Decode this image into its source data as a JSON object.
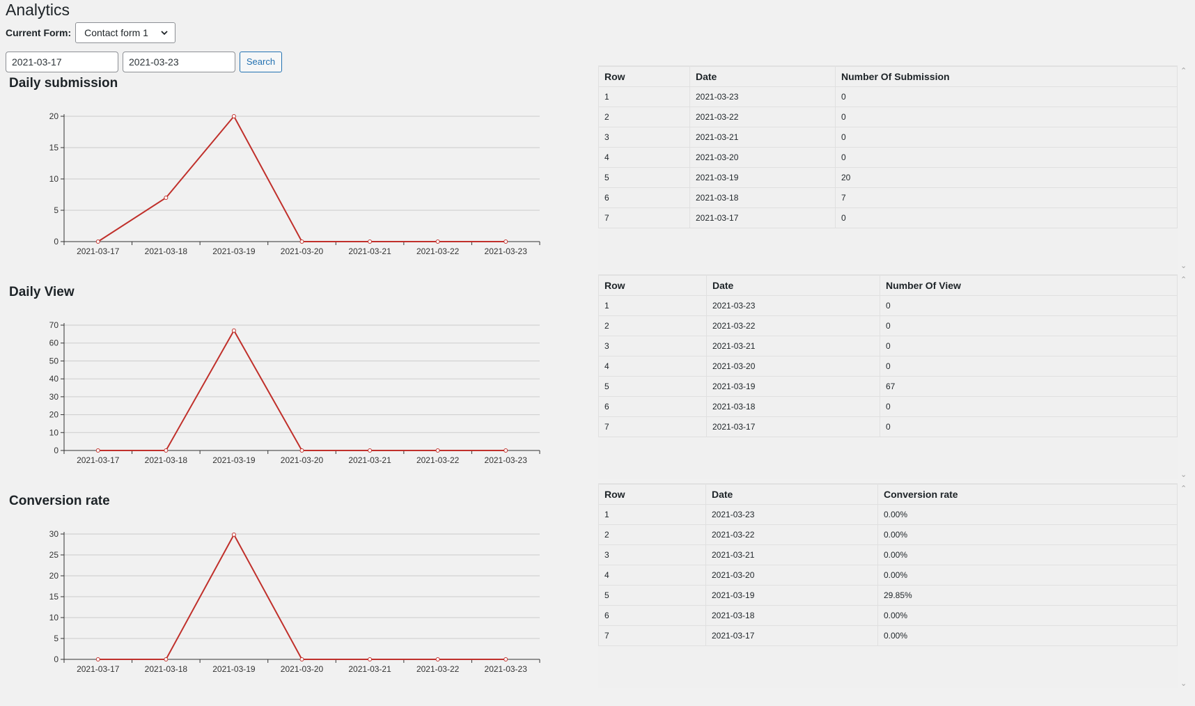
{
  "page": {
    "title": "Analytics",
    "current_form_label": "Current Form:",
    "current_form_value": "Contact form 1",
    "date_from": "2021-03-17",
    "date_to": "2021-03-23",
    "search_label": "Search"
  },
  "colors": {
    "line": "#c0302b",
    "accent": "#2271b1"
  },
  "icons": {
    "select": "chevron-down-icon",
    "scroll_up": "chevron-up-icon",
    "scroll_down": "chevron-down-icon"
  },
  "sections": [
    {
      "title": "Daily submission",
      "table_headers": [
        "Row",
        "Date",
        "Number Of Submission"
      ],
      "rows": [
        [
          "1",
          "2021-03-23",
          "0"
        ],
        [
          "2",
          "2021-03-22",
          "0"
        ],
        [
          "3",
          "2021-03-21",
          "0"
        ],
        [
          "4",
          "2021-03-20",
          "0"
        ],
        [
          "5",
          "2021-03-19",
          "20"
        ],
        [
          "6",
          "2021-03-18",
          "7"
        ],
        [
          "7",
          "2021-03-17",
          "0"
        ]
      ]
    },
    {
      "title": "Daily View",
      "table_headers": [
        "Row",
        "Date",
        "Number Of View"
      ],
      "rows": [
        [
          "1",
          "2021-03-23",
          "0"
        ],
        [
          "2",
          "2021-03-22",
          "0"
        ],
        [
          "3",
          "2021-03-21",
          "0"
        ],
        [
          "4",
          "2021-03-20",
          "0"
        ],
        [
          "5",
          "2021-03-19",
          "67"
        ],
        [
          "6",
          "2021-03-18",
          "0"
        ],
        [
          "7",
          "2021-03-17",
          "0"
        ]
      ]
    },
    {
      "title": "Conversion rate",
      "table_headers": [
        "Row",
        "Date",
        "Conversion rate"
      ],
      "rows": [
        [
          "1",
          "2021-03-23",
          "0.00%"
        ],
        [
          "2",
          "2021-03-22",
          "0.00%"
        ],
        [
          "3",
          "2021-03-21",
          "0.00%"
        ],
        [
          "4",
          "2021-03-20",
          "0.00%"
        ],
        [
          "5",
          "2021-03-19",
          "29.85%"
        ],
        [
          "6",
          "2021-03-18",
          "0.00%"
        ],
        [
          "7",
          "2021-03-17",
          "0.00%"
        ]
      ]
    }
  ],
  "chart_data": [
    {
      "type": "line",
      "categories": [
        "2021-03-17",
        "2021-03-18",
        "2021-03-19",
        "2021-03-20",
        "2021-03-21",
        "2021-03-22",
        "2021-03-23"
      ],
      "values": [
        0,
        7,
        20,
        0,
        0,
        0,
        0
      ],
      "yticks": [
        0,
        5,
        10,
        15,
        20
      ],
      "ylim": [
        0,
        20
      ],
      "grid": true
    },
    {
      "type": "line",
      "categories": [
        "2021-03-17",
        "2021-03-18",
        "2021-03-19",
        "2021-03-20",
        "2021-03-21",
        "2021-03-22",
        "2021-03-23"
      ],
      "values": [
        0,
        0,
        67,
        0,
        0,
        0,
        0
      ],
      "yticks": [
        0,
        10,
        20,
        30,
        40,
        50,
        60,
        70
      ],
      "ylim": [
        0,
        70
      ],
      "grid": true
    },
    {
      "type": "line",
      "categories": [
        "2021-03-17",
        "2021-03-18",
        "2021-03-19",
        "2021-03-20",
        "2021-03-21",
        "2021-03-22",
        "2021-03-23"
      ],
      "values": [
        0,
        0,
        29.85,
        0,
        0,
        0,
        0
      ],
      "yticks": [
        0,
        5,
        10,
        15,
        20,
        25,
        30
      ],
      "ylim": [
        0,
        30
      ],
      "grid": true
    }
  ]
}
